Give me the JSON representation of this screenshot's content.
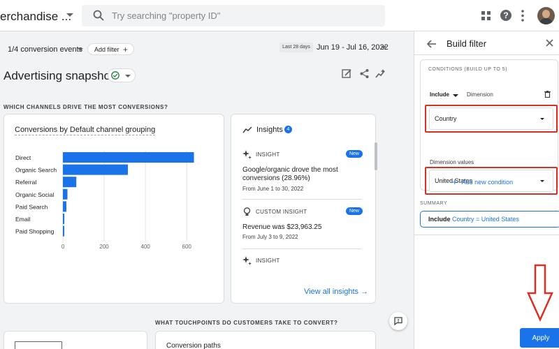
{
  "header": {
    "property_name": "erchandise ...",
    "search_placeholder": "Try searching \"property ID\"",
    "help_glyph": "?"
  },
  "subheader": {
    "conversion_events": "1/4 conversion events",
    "add_filter": "Add filter",
    "add_filter_glyph": "+",
    "date_badge": "Last 28 days",
    "date_range": "Jun 19 - Jul 16, 2022"
  },
  "page": {
    "title": "Advertising snapshot"
  },
  "sections": {
    "channels": "WHICH CHANNELS DRIVE THE MOST CONVERSIONS?",
    "touchpoints": "WHAT TOUCHPOINTS DO CUSTOMERS TAKE TO CONVERT?"
  },
  "conversions_card": {
    "title_part1": "Conversions",
    "title_part2": " by ",
    "title_part3": "Default channel grouping"
  },
  "chart_data": {
    "type": "bar",
    "orientation": "horizontal",
    "categories": [
      "Direct",
      "Organic Search",
      "Referral",
      "Organic Social",
      "Paid Search",
      "Email",
      "Paid Shopping"
    ],
    "values": [
      635,
      315,
      65,
      22,
      17,
      7,
      4
    ],
    "xticks": [
      0,
      200,
      400,
      600
    ],
    "xlim": [
      0,
      650
    ],
    "color": "#1a73e8",
    "gridlines": true
  },
  "insights_card": {
    "title": "Insights",
    "count": "4",
    "items": [
      {
        "label": "INSIGHT",
        "badge": "New",
        "text": "Google/organic drove the most conversions (28.96%)",
        "sub": "From June 1 to 30, 2022"
      },
      {
        "label": "CUSTOM INSIGHT",
        "badge": "New",
        "text": "Revenue was $23,963.25",
        "sub": "From July 3 to 9, 2022"
      },
      {
        "label": "INSIGHT"
      }
    ],
    "view_all": "View all insights →"
  },
  "bottom_card": {
    "title": "Conversion paths"
  },
  "filter_panel": {
    "title": "Build filter",
    "conditions_head": "CONDITIONS (BUILD UP TO 5)",
    "include": "Include",
    "dimension_label": "Dimension",
    "dimension_value": "Country",
    "dimension_values_label": "Dimension values",
    "dimension_values_value": "United States",
    "add_condition": "Add new condition",
    "add_condition_glyph": "+",
    "summary_head": "SUMMARY",
    "summary_include": "Include",
    "summary_condition": "Country = United States",
    "apply": "Apply"
  },
  "colors": {
    "accent": "#1a73e8",
    "annotation_red": "#d93025",
    "success": "#188038"
  }
}
